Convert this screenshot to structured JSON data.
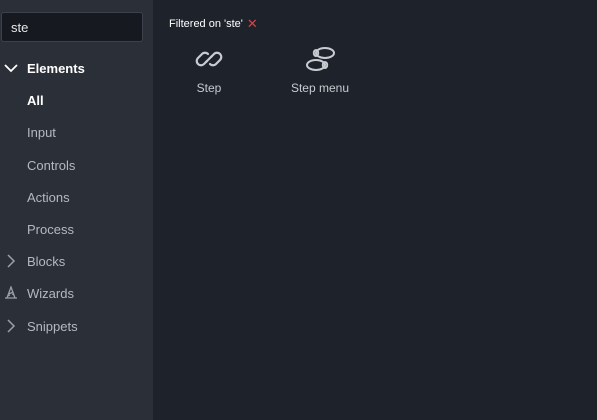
{
  "search": {
    "value": "ste",
    "placeholder": ""
  },
  "sidebar": {
    "section": {
      "label": "Elements",
      "expanded": true,
      "icon": "chevron-down-icon"
    },
    "items": [
      {
        "label": "All",
        "active": true
      },
      {
        "label": "Input",
        "active": false
      },
      {
        "label": "Controls",
        "active": false
      },
      {
        "label": "Actions",
        "active": false
      },
      {
        "label": "Process",
        "active": false
      }
    ],
    "collapsed_groups": [
      {
        "label": "Blocks",
        "icon": "chevron-right-icon"
      },
      {
        "label": "Wizards",
        "icon": "wizard-hat-icon"
      },
      {
        "label": "Snippets",
        "icon": "chevron-right-icon"
      }
    ]
  },
  "filter": {
    "text": "Filtered on 'ste'",
    "clear_icon": "close-icon",
    "clear_color": "#e0403f"
  },
  "results": [
    {
      "label": "Step",
      "icon": "link-icon"
    },
    {
      "label": "Step menu",
      "icon": "footsteps-icon"
    }
  ],
  "colors": {
    "sidebar_bg": "#2b2f38",
    "main_bg": "#1e222b",
    "text_active": "#ffffff",
    "text_muted": "#b4b8bf"
  }
}
